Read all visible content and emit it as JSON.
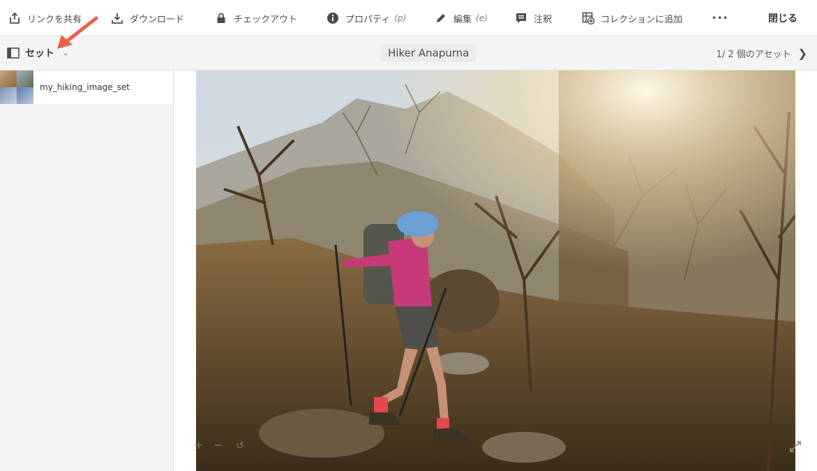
{
  "toolbar": {
    "share_link": "リンクを共有",
    "download": "ダウンロード",
    "checkout": "チェックアウト",
    "properties": "プロパティ",
    "properties_shortcut": "(p)",
    "edit": "編集",
    "edit_shortcut": "(e)",
    "annotate": "注釈",
    "add_to_collection": "コレクションに追加",
    "more": "•••",
    "close": "閉じる"
  },
  "subbar": {
    "set_label": "セット",
    "asset_title": "Hiker Anapurna",
    "pager_text": "1/ 2 個のアセット"
  },
  "rail": {
    "items": [
      {
        "name": "my_hiking_image_set"
      }
    ]
  },
  "colors": {
    "arrow": "#e8624a",
    "toolbar_bg": "#ffffff",
    "subbar_bg": "#f4f4f4"
  }
}
